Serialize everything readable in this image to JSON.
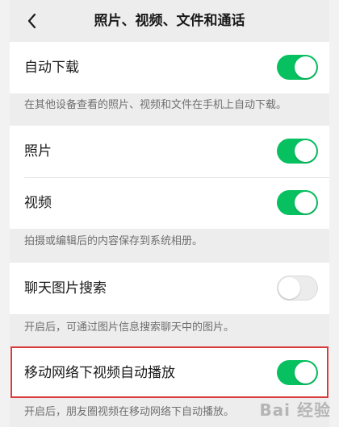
{
  "header": {
    "title": "照片、视频、文件和通话",
    "back_icon": "chevron-left-icon"
  },
  "settings": {
    "auto_download": {
      "label": "自动下载",
      "enabled": true,
      "note": "在其他设备查看的照片、视频和文件在手机上自动下载。"
    },
    "photos": {
      "label": "照片",
      "enabled": true
    },
    "videos": {
      "label": "视频",
      "enabled": true
    },
    "media_note": "拍摄或编辑后的内容保存到系统相册。",
    "chat_image_search": {
      "label": "聊天图片搜索",
      "enabled": false,
      "note": "开启后，可通过图片信息搜索聊天中的图片。"
    },
    "mobile_autoplay": {
      "label": "移动网络下视频自动播放",
      "enabled": true,
      "note": "开启后，朋友圈视频在移动网络下自动播放。"
    }
  },
  "colors": {
    "toggle_on": "#07c160",
    "toggle_off": "#ececec",
    "highlight_border": "#d83b3b"
  },
  "watermark": "Bai 经验"
}
